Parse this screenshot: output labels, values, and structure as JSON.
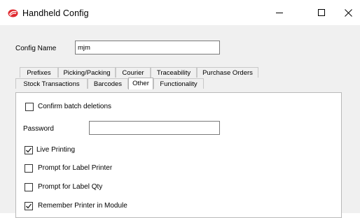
{
  "window": {
    "title": "Handheld Config",
    "icon": "handheld-logo-icon",
    "accent_color": "#e0282e"
  },
  "form": {
    "config_name_label": "Config Name",
    "config_name_value": "mjm"
  },
  "tabs_row1": [
    {
      "label": "Prefixes"
    },
    {
      "label": "Picking/Packing"
    },
    {
      "label": "Courier"
    },
    {
      "label": "Traceability"
    },
    {
      "label": "Purchase Orders"
    }
  ],
  "tabs_row2": [
    {
      "label": "Stock Transactions"
    },
    {
      "label": "Barcodes"
    },
    {
      "label": "Other",
      "active": true
    },
    {
      "label": "Functionality"
    }
  ],
  "other_tab": {
    "confirm_batch_deletions": {
      "label": "Confirm batch deletions",
      "checked": false
    },
    "password_label": "Password",
    "password_value": "",
    "live_printing": {
      "label": "Live Printing",
      "checked": true
    },
    "prompt_label_printer": {
      "label": "Prompt for Label Printer",
      "checked": false
    },
    "prompt_label_qty": {
      "label": "Prompt for Label Qty",
      "checked": false
    },
    "remember_printer": {
      "label": "Remember Printer in Module",
      "checked": true
    }
  }
}
